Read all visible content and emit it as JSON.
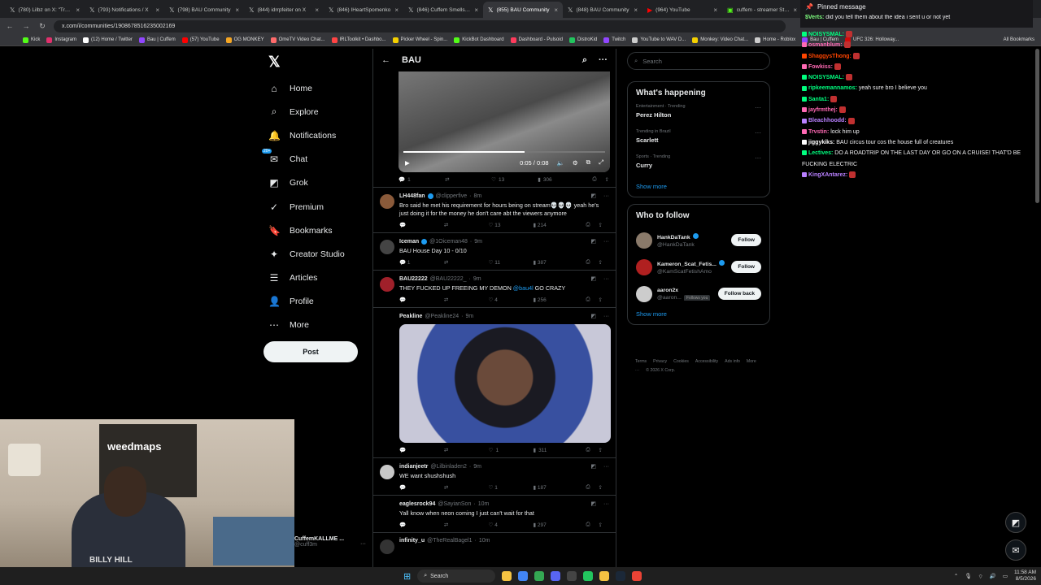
{
  "browser": {
    "tabs": [
      {
        "icon": "x-logo-icon",
        "label": "(780) Lilbz on X: \"Trey h...",
        "active": false
      },
      {
        "icon": "x-logo-icon",
        "label": "(793) Notifications / X",
        "active": false
      },
      {
        "icon": "x-logo-icon",
        "label": "(798) BAU Community",
        "active": false
      },
      {
        "icon": "x-logo-icon",
        "label": "(844) idrrpfeiter on X",
        "active": false
      },
      {
        "icon": "x-logo-icon",
        "label": "(846) IHeartSpomenko",
        "active": false
      },
      {
        "icon": "x-logo-icon",
        "label": "(846) Cuffem Smells Lik...",
        "active": false
      },
      {
        "icon": "x-logo-icon",
        "label": "(855) BAU Community",
        "active": true
      },
      {
        "icon": "x-logo-icon",
        "label": "(848) BAU Community",
        "active": false
      },
      {
        "icon": "youtube-icon",
        "label": "(964) YouTube",
        "active": false
      },
      {
        "icon": "kick-icon",
        "label": "cuffem - streamer Stats",
        "active": false
      }
    ],
    "url": "x.com/i/communities/1908678516235002169",
    "bookmarks": [
      {
        "label": "Kick",
        "color": "#53fc18"
      },
      {
        "label": "Instagram",
        "color": "#e1306c"
      },
      {
        "label": "(12) Home / Twitter",
        "color": "#ffffff"
      },
      {
        "label": "Bau | Cuffem",
        "color": "#9146ff"
      },
      {
        "label": "(57) YouTube",
        "color": "#ff0000"
      },
      {
        "label": "OG MONKEY",
        "color": "#f5a623"
      },
      {
        "label": "OmeTV Video Chat...",
        "color": "#ff6b6b"
      },
      {
        "label": "IRLToolkit • Dashbo...",
        "color": "#ff4444"
      },
      {
        "label": "Picker Wheel - Spin...",
        "color": "#f5d000"
      },
      {
        "label": "KickBot Dashboard",
        "color": "#53fc18"
      },
      {
        "label": "Dashboard - Pulsoid",
        "color": "#ff3b5c"
      },
      {
        "label": "DistroKid",
        "color": "#22c55e"
      },
      {
        "label": "Twitch",
        "color": "#9146ff"
      },
      {
        "label": "YouTube to WAV D...",
        "color": "#cccccc"
      },
      {
        "label": "Monkey: Video Chat...",
        "color": "#f5d000"
      },
      {
        "label": "Home - Roblox",
        "color": "#cccccc"
      },
      {
        "label": "Bau | Cuffem",
        "color": "#9146ff"
      },
      {
        "label": "UFC 326: Holloway...",
        "color": "#d20a0a"
      }
    ],
    "all_bookmarks": "All Bookmarks"
  },
  "x_nav": {
    "items": [
      {
        "icon": "home-icon",
        "glyph": "⌂",
        "label": "Home"
      },
      {
        "icon": "search-icon",
        "glyph": "⌕",
        "label": "Explore"
      },
      {
        "icon": "bell-icon",
        "glyph": "🔔",
        "label": "Notifications"
      },
      {
        "icon": "chat-icon",
        "glyph": "✉",
        "label": "Chat"
      },
      {
        "icon": "grok-icon",
        "glyph": "◩",
        "label": "Grok"
      },
      {
        "icon": "premium-icon",
        "glyph": "✓",
        "label": "Premium"
      },
      {
        "icon": "bookmark-icon",
        "glyph": "🔖",
        "label": "Bookmarks"
      },
      {
        "icon": "creator-studio-icon",
        "glyph": "✦",
        "label": "Creator Studio"
      },
      {
        "icon": "articles-icon",
        "glyph": "☰",
        "label": "Articles"
      },
      {
        "icon": "profile-icon",
        "glyph": "👤",
        "label": "Profile"
      },
      {
        "icon": "more-icon",
        "glyph": "⋯",
        "label": "More"
      }
    ],
    "chat_badge": "20+",
    "post_label": "Post"
  },
  "account": {
    "name": "CuffemKALLME ...",
    "handle": "@cuff3m"
  },
  "feed": {
    "title": "BAU",
    "video": {
      "time": "0:05 / 0:08",
      "progress": 0.6
    },
    "video_actions": {
      "replies": "1",
      "reposts": "",
      "likes": "13",
      "views": "306"
    },
    "tweets": [
      {
        "name": "LH448fan",
        "verified": true,
        "handle": "@clipperfive",
        "time": "8m",
        "text": "Bro said he met his requirement for hours being on stream💀💀💀 yeah he's just doing it for the money he don't care abt the viewers anymore",
        "mention": "",
        "text_after": "",
        "replies": "",
        "reposts": "",
        "likes": "13",
        "views": "214",
        "avatar": "#8a5a3a"
      },
      {
        "name": "Iceman",
        "verified": true,
        "handle": "@1Oiceman48",
        "time": "9m",
        "text": "BAU House Day 10 - 0/10",
        "mention": "",
        "text_after": "",
        "replies": "1",
        "reposts": "",
        "likes": "11",
        "views": "387",
        "avatar": "#444444"
      },
      {
        "name": "BAU22222",
        "verified": false,
        "handle": "@BAU22222_",
        "time": "9m",
        "text": "THEY FUCKED UP FREEING MY DEMON ",
        "mention": "@bau4l",
        "text_after": " GO CRAZY",
        "replies": "",
        "reposts": "",
        "likes": "4",
        "views": "256",
        "avatar": "#a0202a"
      },
      {
        "name": "indianjeetr",
        "verified": false,
        "handle": "@Lilbinladen2",
        "time": "9m",
        "text": "WE want shushshush",
        "mention": "",
        "text_after": "",
        "replies": "",
        "reposts": "",
        "likes": "1",
        "views": "187",
        "avatar": "#c8c8c8"
      },
      {
        "name": "eaglesrock94",
        "verified": false,
        "handle": "@SayianSon",
        "time": "10m",
        "text": "Yall know when neon coming I just can't wait for that",
        "mention": "",
        "text_after": "",
        "replies": "",
        "reposts": "",
        "likes": "4",
        "views": "297",
        "avatar": "#000000"
      }
    ],
    "image_tweet": {
      "name": "Peakline",
      "handle": "@Peakline24",
      "time": "9m",
      "replies": "",
      "reposts": "",
      "likes": "1",
      "views": "311",
      "avatar": "#000000"
    },
    "partial_tweet": {
      "name": "infinity_u",
      "handle": "@TheRealBagel1",
      "time": "10m"
    }
  },
  "right": {
    "search_placeholder": "Search",
    "happening_title": "What's happening",
    "trends": [
      {
        "category": "Entertainment · Trending",
        "name": "Perez Hilton"
      },
      {
        "category": "Trending in Brazil",
        "name": "Scarlett"
      },
      {
        "category": "Sports · Trending",
        "name": "Curry"
      }
    ],
    "show_more": "Show more",
    "wtf_title": "Who to follow",
    "follows": [
      {
        "name": "HankDaTank",
        "verified": true,
        "handle": "@HankDaTank",
        "button": "Follow",
        "follows_you": "",
        "avatar": "#8a7a6a"
      },
      {
        "name": "Kameron_Scat_Fetis...",
        "verified": true,
        "handle": "@KamScatFetishAmo",
        "button": "Follow",
        "follows_you": "",
        "avatar": "#b02020"
      },
      {
        "name": "aaron2x",
        "verified": false,
        "handle": "@aaron...",
        "button": "Follow back",
        "follows_you": "Follows you",
        "avatar": "#cccccc"
      }
    ],
    "footer": [
      "Terms",
      "Privacy",
      "Cookies",
      "Accessibility",
      "Ads info",
      "More ···",
      "© 2026 X Corp."
    ]
  },
  "chat": {
    "pinned_title": "Pinned message",
    "pinned_user": "$Verts:",
    "pinned_text": " did you tell them about the idea i sent u or not yet",
    "messages": [
      {
        "user": "NOISYSMAL:",
        "color": "#00ff7f",
        "text": ""
      },
      {
        "user": "osmanblum:",
        "color": "#ff69b4",
        "text": ""
      },
      {
        "user": "ShaggysThong:",
        "color": "#ff4500",
        "text": ""
      },
      {
        "user": "Fowkiss:",
        "color": "#ff69b4",
        "text": ""
      },
      {
        "user": "NOISYSMAL:",
        "color": "#00ff7f",
        "text": ""
      },
      {
        "user": "ripkeemannamos:",
        "color": "#00ff7f",
        "text": " yeah sure bro I believe you"
      },
      {
        "user": "Santa1:",
        "color": "#00ff7f",
        "text": ""
      },
      {
        "user": "jayfrmthej:",
        "color": "#ff69b4",
        "text": ""
      },
      {
        "user": "Bleachhoodd:",
        "color": "#b980ff",
        "text": ""
      },
      {
        "user": "Trvstin:",
        "color": "#ff69b4",
        "text": " lock him up"
      },
      {
        "user": "jiggykiks:",
        "color": "#ffffff",
        "text": " BAU circus tour cos the house full of creatures"
      },
      {
        "user": "Lectives:",
        "color": "#00ff7f",
        "text": " DO A ROADTRIP ON THE LAST DAY OR GO ON A CRUISE! THAT'D BE FUCKING ELECTRIC"
      },
      {
        "user": "KingXAntarez:",
        "color": "#b980ff",
        "text": ""
      }
    ]
  },
  "taskbar": {
    "search_label": "Search",
    "time": "11:58 AM",
    "date": "8/5/2026",
    "apps": [
      {
        "name": "file-explorer-icon",
        "color": "#f5c342"
      },
      {
        "name": "chrome-icon",
        "color": "#4285f4"
      },
      {
        "name": "chrome-icon",
        "color": "#34a853"
      },
      {
        "name": "discord-icon",
        "color": "#5865f2"
      },
      {
        "name": "obs-icon",
        "color": "#444444"
      },
      {
        "name": "app-icon",
        "color": "#22c55e"
      },
      {
        "name": "folder-icon",
        "color": "#f5c342"
      },
      {
        "name": "steam-icon",
        "color": "#1b2838"
      },
      {
        "name": "chrome-icon",
        "color": "#ea4335"
      }
    ]
  },
  "webcam": {
    "banner": "weedmaps",
    "shirt": "BILLY HILL"
  }
}
